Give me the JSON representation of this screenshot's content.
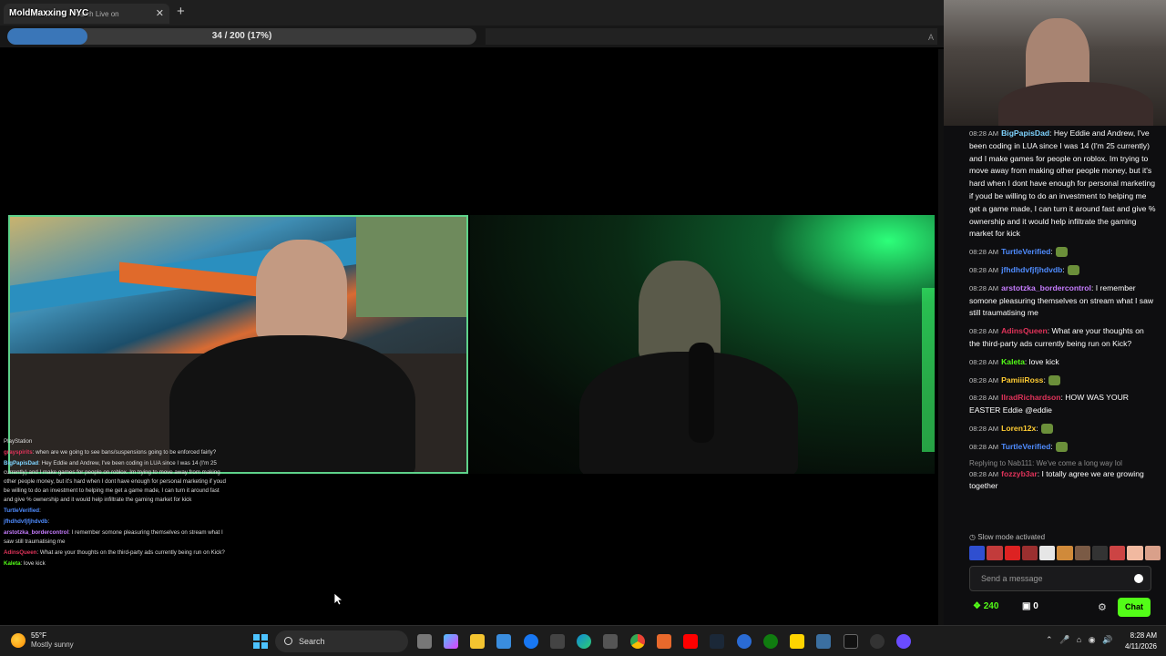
{
  "browser": {
    "tab_title": "Kick Stream - Watch Live on",
    "overlay_title": "MoldMaxxing NYC"
  },
  "progress": {
    "text": "34 / 200 (17%)",
    "fraction": 0.17
  },
  "side_chat": [
    {
      "user": "",
      "text": "PlayStation"
    },
    {
      "user": "grayspirits",
      "text": ": when are we going to see bans/suspensions going to be enforced fairly?"
    },
    {
      "user": "BigPapisDad",
      "text": ": Hey Eddie and Andrew, I've been coding in LUA since I was 14 (I'm 25 currently) and I make games for people on roblox. Im trying to move away from making other people money, but it's hard when I dont have enough for personal marketing if youd be willing to do an investment to helping me get a game made, I can turn it around fast and give % ownership and it would help infiltrate the gaming market for kick"
    },
    {
      "user": "TurtleVerified",
      "text": ":"
    },
    {
      "user": "jfhdhdvfjfjhdvdb",
      "text": ":"
    },
    {
      "user": "arstotzka_bordercontrol",
      "text": ": I remember somone pleasuring themselves on stream what I saw still traumatising me"
    },
    {
      "user": "AdinsQueen",
      "text": ": What are your thoughts on the third-party ads currently being run on Kick?"
    },
    {
      "user": "Kaleta",
      "text": ": love kick"
    }
  ],
  "chat": {
    "messages": [
      {
        "time": "08:28 AM",
        "user": "BigPapisDad",
        "color": "#7fd4ff",
        "text": ": Hey Eddie and Andrew, I've been coding in LUA since I was 14 (I'm 25 currently) and I make games for people on roblox. Im trying to move away from making other people money, but it's hard when I dont have enough for personal marketing if youd be willing to do an investment to helping me get a game made, I can turn it around fast and give % ownership and it would help infiltrate the gaming market for kick"
      },
      {
        "time": "08:28 AM",
        "user": "TurtleVerified",
        "color": "#4f8cff",
        "text": ":"
      },
      {
        "time": "08:28 AM",
        "user": "jfhdhdvfjfjhdvdb",
        "color": "#4f8cff",
        "text": ":"
      },
      {
        "time": "08:28 AM",
        "user": "arstotzka_bordercontrol",
        "color": "#c77dff",
        "text": ": I remember somone pleasuring themselves on stream what I saw still traumatising me"
      },
      {
        "time": "08:28 AM",
        "user": "AdinsQueen",
        "color": "#e0335a",
        "text": ": What are your thoughts on the third-party ads currently being run on Kick?"
      },
      {
        "time": "08:28 AM",
        "user": "Kaleta",
        "color": "#53fc18",
        "text": ": love kick"
      },
      {
        "time": "08:28 AM",
        "user": "PamiiiRoss",
        "color": "#ffcc33",
        "text": ":"
      },
      {
        "time": "08:28 AM",
        "user": "IlradRichardson",
        "color": "#e0335a",
        "text": ": HOW WAS YOUR EASTER Eddie @eddie"
      },
      {
        "time": "08:28 AM",
        "user": "Loren12x",
        "color": "#ffcc33",
        "text": ":"
      },
      {
        "time": "08:28 AM",
        "user": "TurtleVerified",
        "color": "#4f8cff",
        "text": ":"
      }
    ],
    "reply_to": "Replying to Nab111: We've come a long way lol",
    "reply_message": {
      "time": "08:28 AM",
      "user": "fozzyb3ar",
      "color": "#e0335a",
      "text": ": I totally agree we are growing together"
    },
    "slow_mode": "Slow mode activated",
    "input_placeholder": "Send a message",
    "points": "240",
    "store_count": "0",
    "send_label": "Chat",
    "accent": "#53fc18"
  },
  "taskbar": {
    "temperature": "55°F",
    "weather": "Mostly sunny",
    "search_label": "Search",
    "time": "8:28 AM",
    "date": "4/11/2026"
  }
}
